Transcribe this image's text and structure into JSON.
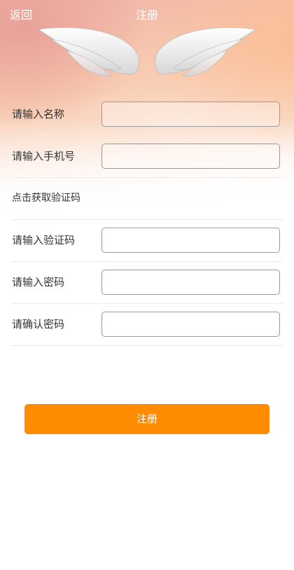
{
  "header": {
    "back_label": "返回",
    "title": "注册"
  },
  "form": {
    "rows": [
      {
        "label": "请输入名称",
        "value": "",
        "placeholder": ""
      },
      {
        "label": "请输入手机号",
        "value": "",
        "placeholder": ""
      },
      {
        "label": "点击获取验证码"
      },
      {
        "label": "请输入验证码",
        "value": "",
        "placeholder": ""
      },
      {
        "label": "请输入密码",
        "value": "",
        "placeholder": ""
      },
      {
        "label": "请确认密码",
        "value": "",
        "placeholder": ""
      }
    ]
  },
  "submit": {
    "label": "注册",
    "color": "#ff8c00"
  },
  "icons": {
    "header_image": "angel-wings-icon"
  }
}
